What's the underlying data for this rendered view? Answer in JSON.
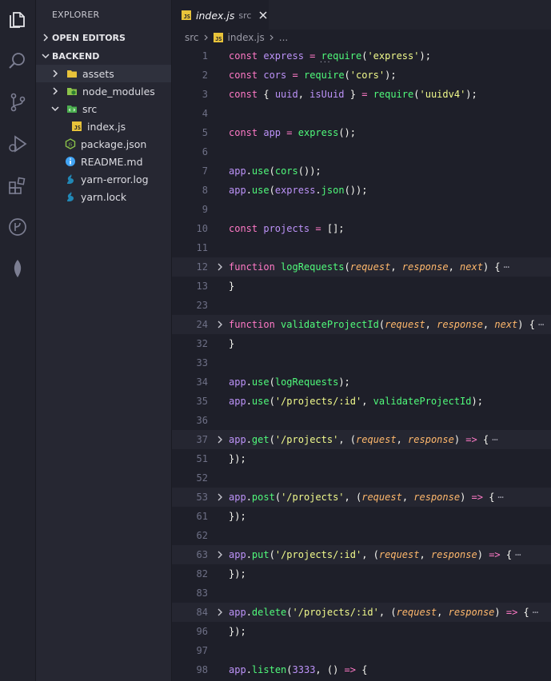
{
  "explorer": {
    "title": "EXPLORER",
    "sections": {
      "open_editors": "OPEN EDITORS",
      "backend": "BACKEND"
    },
    "tree": [
      {
        "label": "assets",
        "kind": "folder"
      },
      {
        "label": "node_modules",
        "kind": "folder"
      },
      {
        "label": "src",
        "kind": "folder-open"
      },
      {
        "label": "index.js",
        "kind": "js"
      },
      {
        "label": "package.json",
        "kind": "node"
      },
      {
        "label": "README.md",
        "kind": "info"
      },
      {
        "label": "yarn-error.log",
        "kind": "yarn"
      },
      {
        "label": "yarn.lock",
        "kind": "yarn"
      }
    ]
  },
  "tab": {
    "icon_text": "JS",
    "name": "index.js",
    "dir": "src"
  },
  "breadcrumb": {
    "folder": "src",
    "file": "index.js",
    "more": "..."
  },
  "colors": {
    "keyword": "#ff79c6",
    "variable": "#bd93f9",
    "function": "#50fa7b",
    "string": "#f1fa8c",
    "param": "#ffb86c"
  },
  "code": {
    "ellipsis": "⋯",
    "lines": [
      {
        "n": "1",
        "tokens": [
          [
            "k",
            "const"
          ],
          [
            "w",
            " "
          ],
          [
            "v",
            "express"
          ],
          [
            "w",
            " "
          ],
          [
            "k",
            "="
          ],
          [
            "w",
            " "
          ],
          [
            "f",
            "require"
          ],
          [
            "w",
            "("
          ],
          [
            "s",
            "'express'"
          ],
          [
            "w",
            ");"
          ]
        ]
      },
      {
        "n": "2",
        "tokens": [
          [
            "k",
            "const"
          ],
          [
            "w",
            " "
          ],
          [
            "v",
            "cors"
          ],
          [
            "w",
            " "
          ],
          [
            "k",
            "="
          ],
          [
            "w",
            " "
          ],
          [
            "f",
            "require"
          ],
          [
            "w",
            "("
          ],
          [
            "s",
            "'cors'"
          ],
          [
            "w",
            ");"
          ]
        ]
      },
      {
        "n": "3",
        "tokens": [
          [
            "k",
            "const"
          ],
          [
            "w",
            " { "
          ],
          [
            "v",
            "uuid"
          ],
          [
            "w",
            ", "
          ],
          [
            "v",
            "isUuid"
          ],
          [
            "w",
            " } "
          ],
          [
            "k",
            "="
          ],
          [
            "w",
            " "
          ],
          [
            "f",
            "require"
          ],
          [
            "w",
            "("
          ],
          [
            "s",
            "'uuidv4'"
          ],
          [
            "w",
            ");"
          ]
        ]
      },
      {
        "n": "4",
        "tokens": []
      },
      {
        "n": "5",
        "tokens": [
          [
            "k",
            "const"
          ],
          [
            "w",
            " "
          ],
          [
            "v",
            "app"
          ],
          [
            "w",
            " "
          ],
          [
            "k",
            "="
          ],
          [
            "w",
            " "
          ],
          [
            "f",
            "express"
          ],
          [
            "w",
            "();"
          ]
        ]
      },
      {
        "n": "6",
        "tokens": []
      },
      {
        "n": "7",
        "tokens": [
          [
            "v",
            "app"
          ],
          [
            "w",
            "."
          ],
          [
            "f",
            "use"
          ],
          [
            "w",
            "("
          ],
          [
            "f",
            "cors"
          ],
          [
            "w",
            "());"
          ]
        ]
      },
      {
        "n": "8",
        "tokens": [
          [
            "v",
            "app"
          ],
          [
            "w",
            "."
          ],
          [
            "f",
            "use"
          ],
          [
            "w",
            "("
          ],
          [
            "v",
            "express"
          ],
          [
            "w",
            "."
          ],
          [
            "f",
            "json"
          ],
          [
            "w",
            "());"
          ]
        ]
      },
      {
        "n": "9",
        "tokens": []
      },
      {
        "n": "10",
        "tokens": [
          [
            "k",
            "const"
          ],
          [
            "w",
            " "
          ],
          [
            "v",
            "projects"
          ],
          [
            "w",
            " "
          ],
          [
            "k",
            "="
          ],
          [
            "w",
            " [];"
          ]
        ]
      },
      {
        "n": "11",
        "tokens": []
      },
      {
        "n": "12",
        "fold": true,
        "tokens": [
          [
            "k",
            "function"
          ],
          [
            "w",
            " "
          ],
          [
            "f",
            "logRequests"
          ],
          [
            "w",
            "("
          ],
          [
            "p",
            "request"
          ],
          [
            "w",
            ", "
          ],
          [
            "p",
            "response"
          ],
          [
            "w",
            ", "
          ],
          [
            "p",
            "next"
          ],
          [
            "w",
            ") {"
          ]
        ]
      },
      {
        "n": "",
        "tokens": [
          [
            "w",
            "}"
          ]
        ]
      },
      {
        "n": "23",
        "tokens": []
      },
      {
        "n": "24",
        "fold": true,
        "tokens": [
          [
            "k",
            "function"
          ],
          [
            "w",
            " "
          ],
          [
            "f",
            "validateProjectId"
          ],
          [
            "w",
            "("
          ],
          [
            "p",
            "request"
          ],
          [
            "w",
            ", "
          ],
          [
            "p",
            "response"
          ],
          [
            "w",
            ", "
          ],
          [
            "p",
            "next"
          ],
          [
            "w",
            ") {"
          ]
        ]
      },
      {
        "n": "32",
        "tokens": [
          [
            "w",
            "}"
          ]
        ]
      },
      {
        "n": "33",
        "tokens": []
      },
      {
        "n": "34",
        "tokens": [
          [
            "v",
            "app"
          ],
          [
            "w",
            "."
          ],
          [
            "f",
            "use"
          ],
          [
            "w",
            "("
          ],
          [
            "f",
            "logRequests"
          ],
          [
            "w",
            ");"
          ]
        ]
      },
      {
        "n": "35",
        "tokens": [
          [
            "v",
            "app"
          ],
          [
            "w",
            "."
          ],
          [
            "f",
            "use"
          ],
          [
            "w",
            "("
          ],
          [
            "s",
            "'/projects/:id'"
          ],
          [
            "w",
            ", "
          ],
          [
            "f",
            "validateProjectId"
          ],
          [
            "w",
            ");"
          ]
        ]
      },
      {
        "n": "36",
        "tokens": []
      },
      {
        "n": "37",
        "fold": true,
        "tokens": [
          [
            "v",
            "app"
          ],
          [
            "w",
            "."
          ],
          [
            "f",
            "get"
          ],
          [
            "w",
            "("
          ],
          [
            "s",
            "'/projects'"
          ],
          [
            "w",
            ", ("
          ],
          [
            "p",
            "request"
          ],
          [
            "w",
            ", "
          ],
          [
            "p",
            "response"
          ],
          [
            "w",
            ") "
          ],
          [
            "k",
            "=>"
          ],
          [
            "w",
            " {"
          ]
        ]
      },
      {
        "n": "51",
        "tokens": [
          [
            "w",
            "});"
          ]
        ]
      },
      {
        "n": "52",
        "tokens": []
      },
      {
        "n": "53",
        "fold": true,
        "tokens": [
          [
            "v",
            "app"
          ],
          [
            "w",
            "."
          ],
          [
            "f",
            "post"
          ],
          [
            "w",
            "("
          ],
          [
            "s",
            "'/projects'"
          ],
          [
            "w",
            ", ("
          ],
          [
            "p",
            "request"
          ],
          [
            "w",
            ", "
          ],
          [
            "p",
            "response"
          ],
          [
            "w",
            ") "
          ],
          [
            "k",
            "=>"
          ],
          [
            "w",
            " {"
          ]
        ]
      },
      {
        "n": "61",
        "tokens": [
          [
            "w",
            "});"
          ]
        ]
      },
      {
        "n": "62",
        "tokens": []
      },
      {
        "n": "63",
        "fold": true,
        "tokens": [
          [
            "v",
            "app"
          ],
          [
            "w",
            "."
          ],
          [
            "f",
            "put"
          ],
          [
            "w",
            "("
          ],
          [
            "s",
            "'/projects/:id'"
          ],
          [
            "w",
            ", ("
          ],
          [
            "p",
            "request"
          ],
          [
            "w",
            ", "
          ],
          [
            "p",
            "response"
          ],
          [
            "w",
            ") "
          ],
          [
            "k",
            "=>"
          ],
          [
            "w",
            " {"
          ]
        ]
      },
      {
        "n": "82",
        "tokens": [
          [
            "w",
            "});"
          ]
        ]
      },
      {
        "n": "83",
        "tokens": []
      },
      {
        "n": "84",
        "fold": true,
        "tokens": [
          [
            "v",
            "app"
          ],
          [
            "w",
            "."
          ],
          [
            "f",
            "delete"
          ],
          [
            "w",
            "("
          ],
          [
            "s",
            "'/projects/:id'"
          ],
          [
            "w",
            ", ("
          ],
          [
            "p",
            "request"
          ],
          [
            "w",
            ", "
          ],
          [
            "p",
            "response"
          ],
          [
            "w",
            ") "
          ],
          [
            "k",
            "=>"
          ],
          [
            "w",
            " {"
          ]
        ]
      },
      {
        "n": "96",
        "tokens": [
          [
            "w",
            "});"
          ]
        ]
      },
      {
        "n": "97",
        "tokens": []
      },
      {
        "n": "98",
        "tokens": [
          [
            "v",
            "app"
          ],
          [
            "w",
            "."
          ],
          [
            "f",
            "listen"
          ],
          [
            "w",
            "("
          ],
          [
            "v",
            "3333"
          ],
          [
            "w",
            ", () "
          ],
          [
            "k",
            "=>"
          ],
          [
            "w",
            " {"
          ]
        ]
      }
    ]
  }
}
